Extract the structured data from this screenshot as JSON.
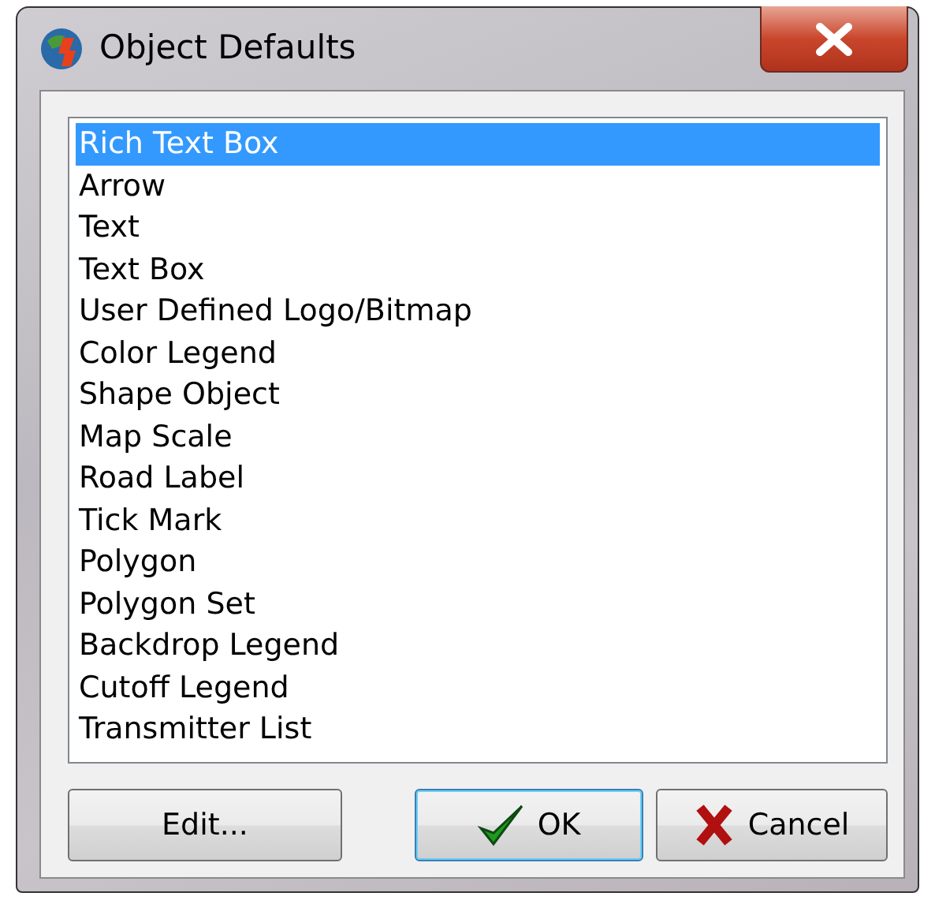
{
  "window": {
    "title": "Object Defaults"
  },
  "list": [
    {
      "label": "Rich Text Box",
      "selected": true
    },
    {
      "label": "Arrow",
      "selected": false
    },
    {
      "label": "Text",
      "selected": false
    },
    {
      "label": "Text Box",
      "selected": false
    },
    {
      "label": "User Defined Logo/Bitmap",
      "selected": false
    },
    {
      "label": "Color Legend",
      "selected": false
    },
    {
      "label": "Shape Object",
      "selected": false
    },
    {
      "label": "Map Scale",
      "selected": false
    },
    {
      "label": "Road Label",
      "selected": false
    },
    {
      "label": "Tick Mark",
      "selected": false
    },
    {
      "label": "Polygon",
      "selected": false
    },
    {
      "label": "Polygon Set",
      "selected": false
    },
    {
      "label": "Backdrop Legend",
      "selected": false
    },
    {
      "label": "Cutoff Legend",
      "selected": false
    },
    {
      "label": "Transmitter List",
      "selected": false
    }
  ],
  "buttons": [
    {
      "label": "Edit...",
      "kind": "plain",
      "default": false
    },
    {
      "label": "OK",
      "kind": "ok",
      "default": true
    },
    {
      "label": "Cancel",
      "kind": "cancel",
      "default": false
    }
  ]
}
